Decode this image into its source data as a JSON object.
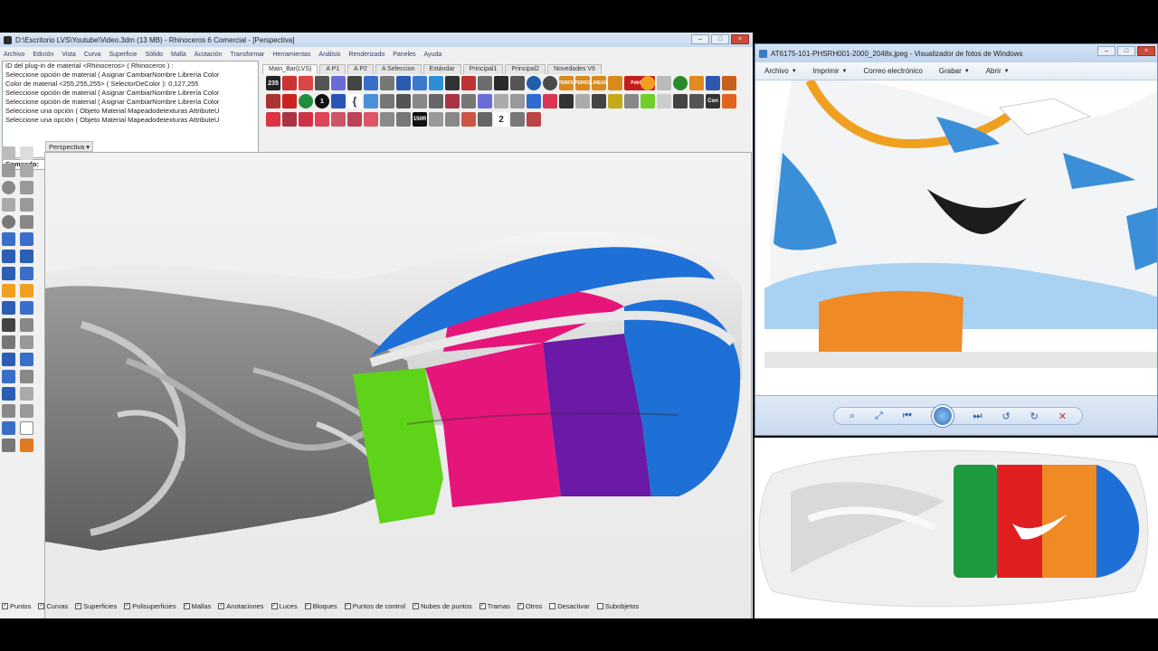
{
  "rhino": {
    "title": "D:\\Escritorio LVS\\Youtube\\Video.3dm (13 MB) - Rhinoceros 6 Comercial - [Perspectiva]",
    "window_buttons": [
      "–",
      "□",
      "×"
    ],
    "menu": [
      "Archivo",
      "Edición",
      "Vista",
      "Curva",
      "Superficie",
      "Sólido",
      "Malla",
      "Acotación",
      "Transformar",
      "Herramientas",
      "Análisis",
      "Renderizado",
      "Paneles",
      "Ayuda"
    ],
    "history": [
      "ID del plug-in de material <Rhinoceros> ( Rhinoceros ) :",
      "Seleccione opción de material ( Asignar  CambiarNombre  Librería  Color",
      "Color de material <255,255,255> ( SelectorDeColor ): 0,127,255",
      "Seleccione opción de material ( Asignar  CambiarNombre  Librería  Color",
      "Seleccione opción de material ( Asignar  CambiarNombre  Librería  Color",
      "Seleccione una opción ( Objeto  Material  Mapeadodetexturas  AttributeU",
      "Seleccione una opción ( Objeto  Material  Mapeadodetexturas  AttributeU"
    ],
    "command_label": "Comando:",
    "tabs": [
      "Main_Bar(LVS)",
      "A P1",
      "A P2",
      "A Seleccion",
      "Estándar",
      "Principal1",
      "Principal2",
      "Novedades V6"
    ],
    "active_tab_index": 0,
    "viewport_label": "Perspectiva",
    "osnaps": [
      {
        "label": "Puntos",
        "checked": true
      },
      {
        "label": "Curvas",
        "checked": true
      },
      {
        "label": "Superficies",
        "checked": true
      },
      {
        "label": "Polisuperficies",
        "checked": true
      },
      {
        "label": "Mallas",
        "checked": true
      },
      {
        "label": "Anotaciones",
        "checked": true
      },
      {
        "label": "Luces",
        "checked": true
      },
      {
        "label": "Bloques",
        "checked": true
      },
      {
        "label": "Puntos de control",
        "checked": true
      },
      {
        "label": "Nubes de puntos",
        "checked": true
      },
      {
        "label": "Tramas",
        "checked": true
      },
      {
        "label": "Otros",
        "checked": true
      },
      {
        "label": "Desactivar",
        "checked": false
      },
      {
        "label": "Subobjetos",
        "checked": false
      }
    ],
    "toolbar_text": {
      "badge_235": "235",
      "perfil": "PERFIL",
      "perso": "PERSO",
      "lineas": "LINEAS",
      "pdir_pdir": "PdirPdir",
      "con": "Con",
      "n150": "150R",
      "n1": "1",
      "n2": "2"
    }
  },
  "viewer": {
    "title": "AT6175-101-PHSRH001-2000_2048x.jpeg - Visualizador de fotos de Windows",
    "menu": [
      {
        "label": "Archivo",
        "has_dropdown": true
      },
      {
        "label": "Imprimir",
        "has_dropdown": true
      },
      {
        "label": "Correo electrónico",
        "has_dropdown": false
      },
      {
        "label": "Grabar",
        "has_dropdown": true
      },
      {
        "label": "Abrir",
        "has_dropdown": true
      }
    ],
    "window_buttons": [
      "–",
      "□",
      "×"
    ],
    "controls": [
      "zoom-icon",
      "fit-icon",
      "previous-icon",
      "slideshow-icon",
      "next-icon",
      "rotate-left-icon",
      "rotate-right-icon",
      "delete-icon"
    ]
  },
  "colors": {
    "sole_green": "#5fd21a",
    "sole_magenta": "#e5157a",
    "sole_purple": "#6a1aa6",
    "sole_blue": "#1e6fd6",
    "sole_grey": "#8a8a8a",
    "shoe_orange": "#f08a24",
    "shoe_blue": "#3b8fd8"
  }
}
